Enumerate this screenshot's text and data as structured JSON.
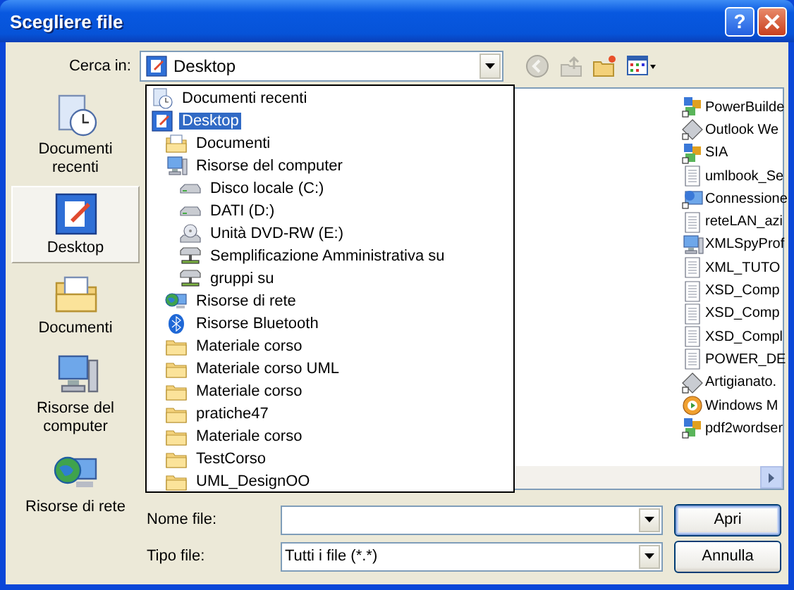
{
  "window": {
    "title": "Scegliere file"
  },
  "help_button": {
    "label": "?"
  },
  "look_in": {
    "label": "Cerca in:",
    "value": "Desktop",
    "kind": "desktop"
  },
  "toolbar": [
    {
      "kind": "back",
      "disabled": true
    },
    {
      "kind": "up",
      "disabled": true
    },
    {
      "kind": "new_folder",
      "disabled": false
    },
    {
      "kind": "views",
      "disabled": false
    }
  ],
  "places": [
    {
      "label": "Documenti recenti",
      "kind": "recent",
      "selected": false
    },
    {
      "label": "Desktop",
      "kind": "desktop",
      "selected": true
    },
    {
      "label": "Documenti",
      "kind": "documents",
      "selected": false
    },
    {
      "label": "Risorse del computer",
      "kind": "computer",
      "selected": false
    },
    {
      "label": "Risorse di rete",
      "kind": "network",
      "selected": false
    }
  ],
  "dropdown": {
    "items": [
      {
        "label": "Documenti recenti",
        "kind": "recent",
        "selected": false
      },
      {
        "label": "Desktop",
        "kind": "desktop",
        "selected": true,
        "children": [
          {
            "label": "Documenti",
            "kind": "documents",
            "selected": false
          },
          {
            "label": "Risorse del computer",
            "kind": "computer",
            "selected": false,
            "children": [
              {
                "label": "Disco locale (C:)",
                "kind": "drive",
                "selected": false
              },
              {
                "label": "DATI (D:)",
                "kind": "drive",
                "selected": false
              },
              {
                "label": "Unità DVD-RW (E:)",
                "kind": "dvd",
                "selected": false
              },
              {
                "label": "Semplificazione Amministrativa su",
                "kind": "netdrive",
                "selected": false
              },
              {
                "label": "gruppi su",
                "kind": "netdrive",
                "selected": false
              }
            ]
          },
          {
            "label": "Risorse di rete",
            "kind": "network",
            "selected": false
          },
          {
            "label": "Risorse Bluetooth",
            "kind": "bluetooth",
            "selected": false
          },
          {
            "label": "Materiale corso",
            "kind": "folder",
            "selected": false
          },
          {
            "label": "Materiale corso UML",
            "kind": "folder",
            "selected": false
          },
          {
            "label": "Materiale corso",
            "kind": "folder",
            "selected": false
          },
          {
            "label": "pratiche47",
            "kind": "folder",
            "selected": false
          },
          {
            "label": "Materiale corso",
            "kind": "folder",
            "selected": false
          },
          {
            "label": "TestCorso",
            "kind": "folder",
            "selected": false
          },
          {
            "label": "UML_DesignOO",
            "kind": "folder",
            "selected": false
          }
        ]
      }
    ]
  },
  "files": [
    {
      "name": "PowerBuilde",
      "kind": "app"
    },
    {
      "name": "Outlook  We",
      "kind": "shortcut"
    },
    {
      "name": "SIA",
      "kind": "app"
    },
    {
      "name": "umlbook_Se",
      "kind": "text"
    },
    {
      "name": "Connessione",
      "kind": "connection"
    },
    {
      "name": "reteLAN_azi",
      "kind": "text"
    },
    {
      "name": "XMLSpyProf",
      "kind": "computer"
    },
    {
      "name": "XML_TUTO",
      "kind": "text"
    },
    {
      "name": "XSD_Comp",
      "kind": "text"
    },
    {
      "name": "XSD_Comp",
      "kind": "text"
    },
    {
      "name": "XSD_Compl",
      "kind": "text"
    },
    {
      "name": "POWER_DE",
      "kind": "text"
    },
    {
      "name": "Artigianato.",
      "kind": "shortcut"
    },
    {
      "name": "Windows M",
      "kind": "media"
    },
    {
      "name": "pdf2wordser",
      "kind": "app"
    }
  ],
  "file_name": {
    "label": "Nome file:"
  },
  "file_type": {
    "label": "Tipo file:",
    "value": "Tutti i file (*.*)"
  },
  "buttons": [
    {
      "label": "Apri",
      "default": true
    },
    {
      "label": "Annulla",
      "default": false
    }
  ]
}
